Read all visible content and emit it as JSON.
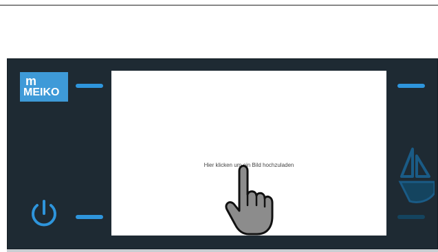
{
  "brand": {
    "logo_mark": "m",
    "logo_name": "MEIKO"
  },
  "screen": {
    "upload_hint": "Hier klicken um ein Bild hochzuladen"
  },
  "icons": {
    "power": "power-icon",
    "cursor": "pointing-hand-icon",
    "wash": "ship-icon"
  },
  "colors": {
    "panel": "#1e2a33",
    "accent": "#2e95dc",
    "logo_bg": "#3e9ad8",
    "screen_bg": "#ffffff"
  }
}
